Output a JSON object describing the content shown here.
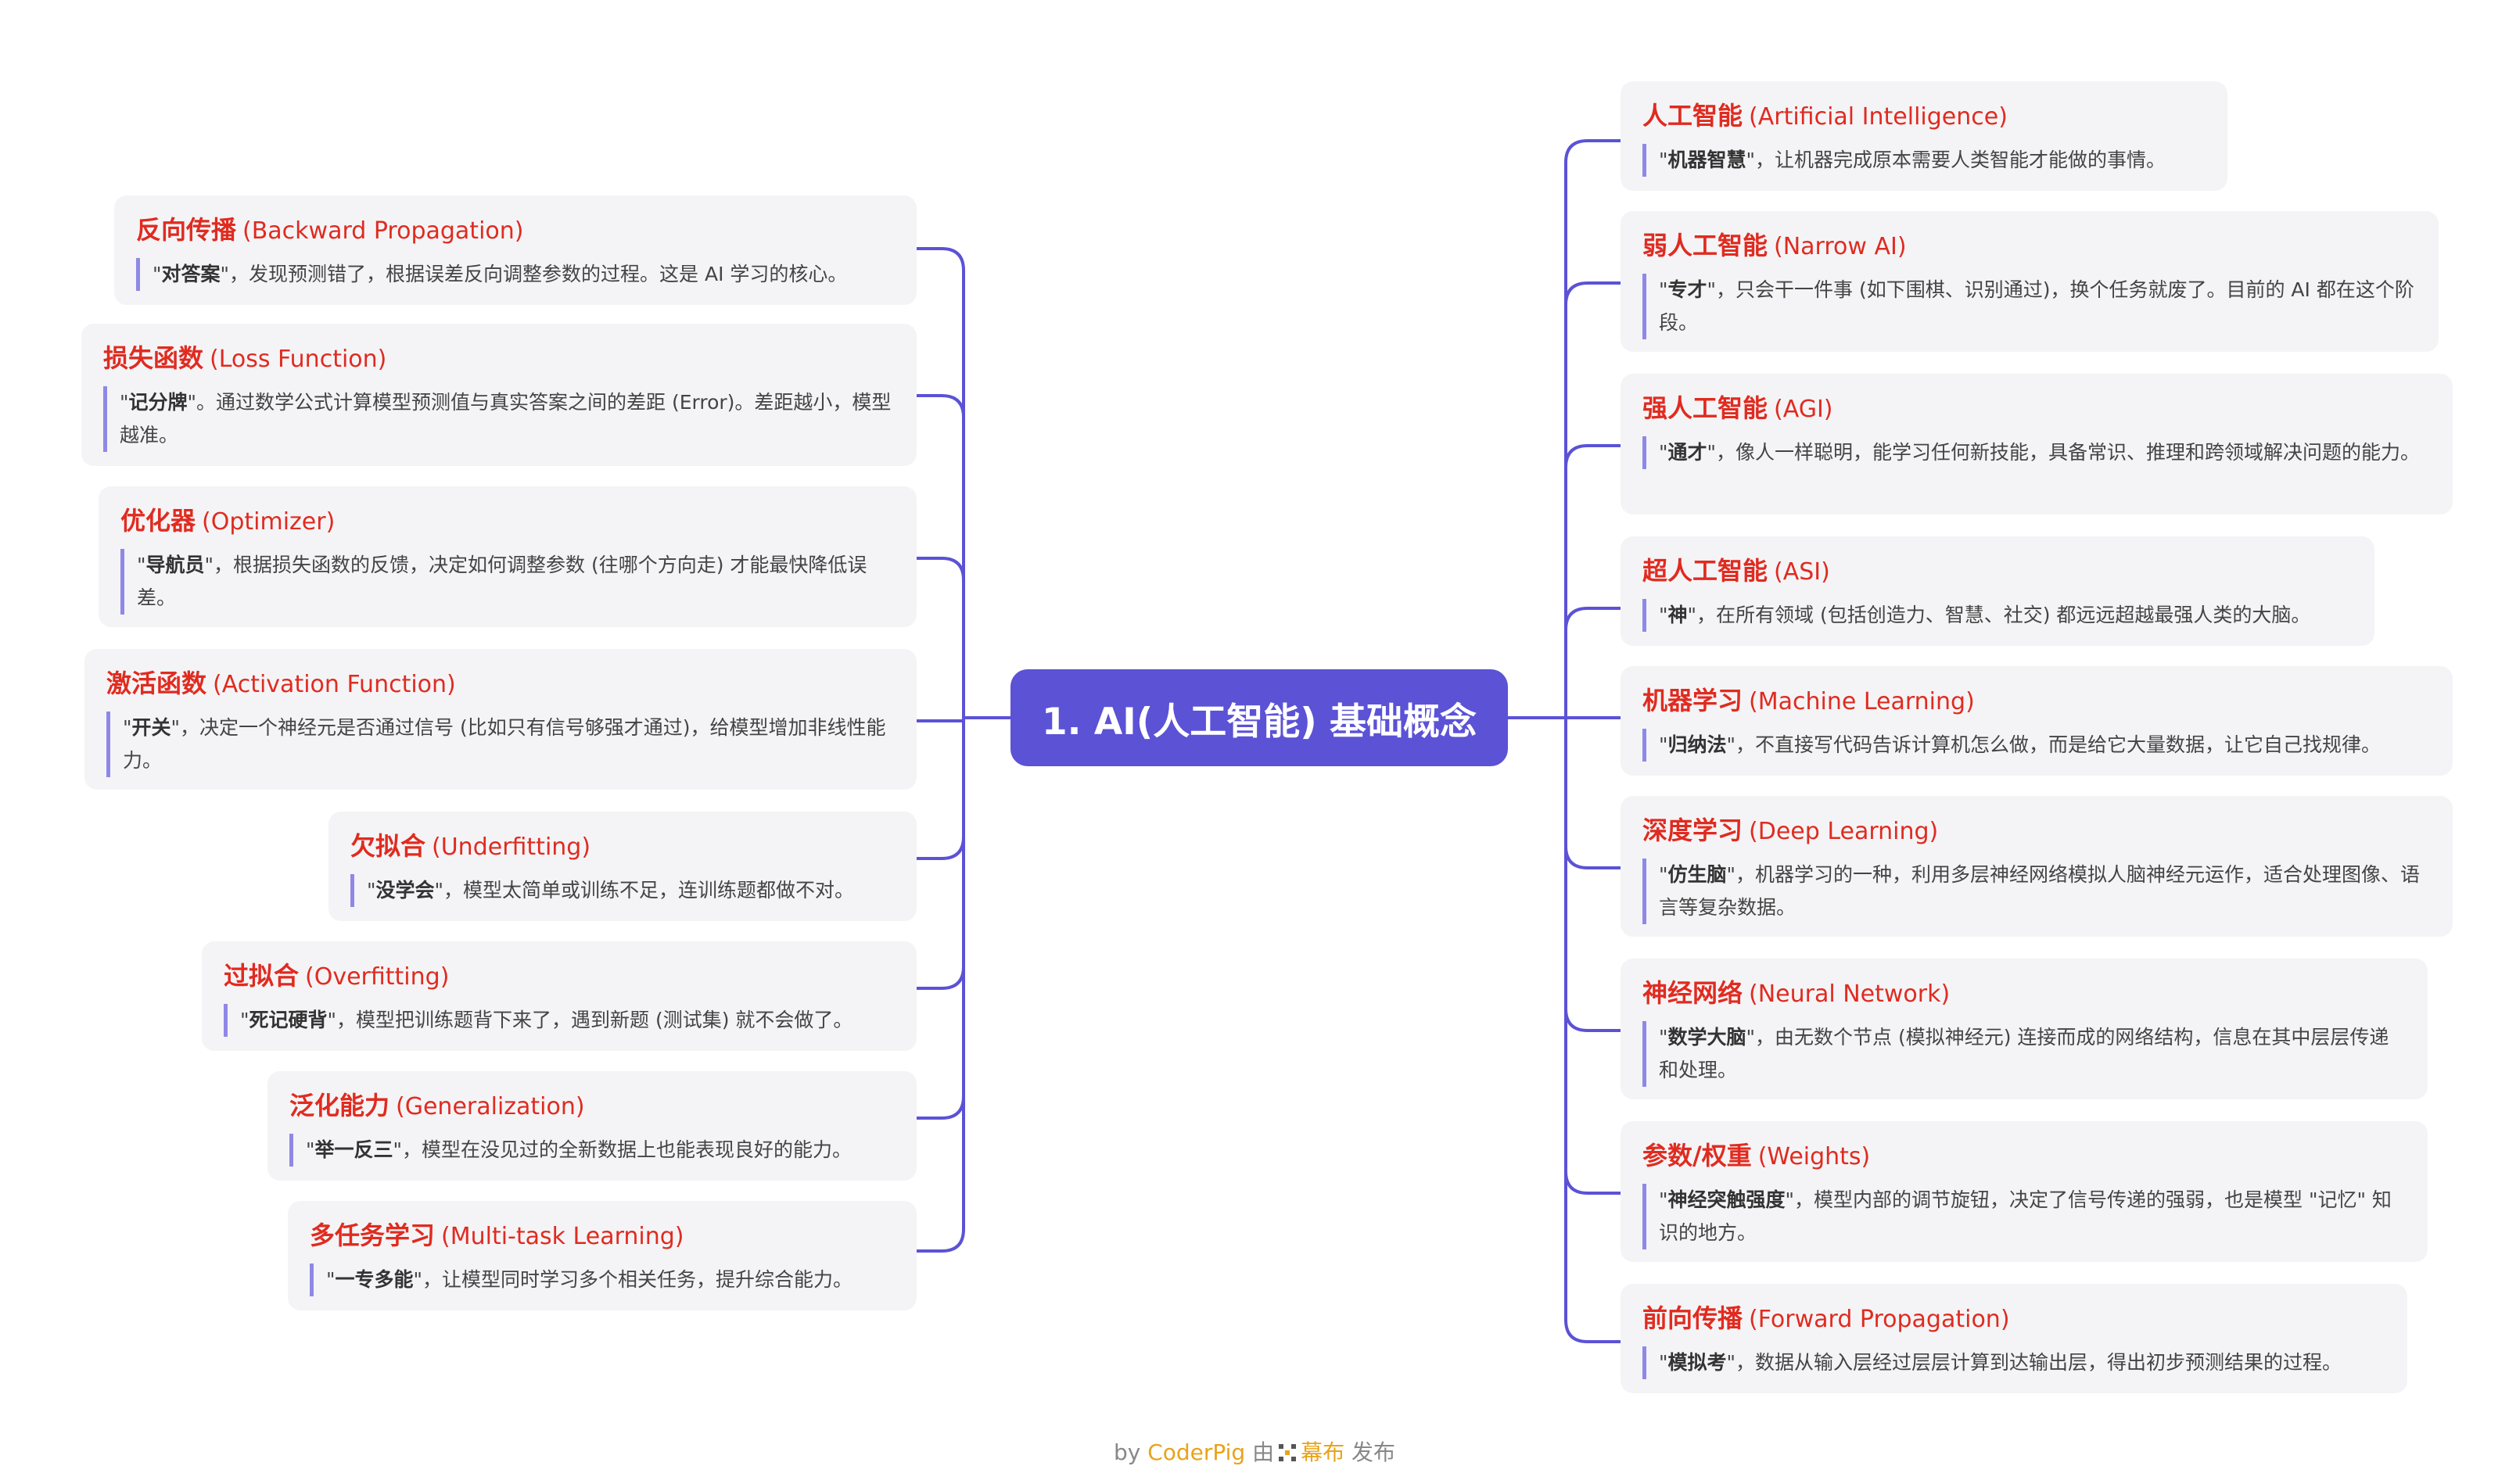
{
  "center": {
    "label": "1. AI(人工智能) 基础概念"
  },
  "right_nodes": [
    {
      "id": "ai",
      "title_zh": "人工智能",
      "title_en": "(Artificial Intelligence)",
      "bold": "机器智慧",
      "desc": "，让机器完成原本需要人类智能才能做的事情。"
    },
    {
      "id": "narrow-ai",
      "title_zh": "弱人工智能",
      "title_en": "(Narrow AI)",
      "bold": "专才",
      "desc": "，只会干一件事 (如下围棋、识别通过)，换个任务就废了。目前的 AI 都在这个阶段。"
    },
    {
      "id": "agi",
      "title_zh": "强人工智能",
      "title_en": "(AGI)",
      "bold": "通才",
      "desc": "，像人一样聪明，能学习任何新技能，具备常识、推理和跨领域解决问题的能力。"
    },
    {
      "id": "asi",
      "title_zh": "超人工智能",
      "title_en": "(ASI)",
      "bold": "神",
      "desc": "，在所有领域 (包括创造力、智慧、社交) 都远远超越最强人类的大脑。"
    },
    {
      "id": "machine-learning",
      "title_zh": "机器学习",
      "title_en": "(Machine Learning)",
      "bold": "归纳法",
      "desc": "，不直接写代码告诉计算机怎么做，而是给它大量数据，让它自己找规律。"
    },
    {
      "id": "deep-learning",
      "title_zh": "深度学习",
      "title_en": "(Deep Learning)",
      "bold": "仿生脑",
      "desc": "，机器学习的一种，利用多层神经网络模拟人脑神经元运作，适合处理图像、语言等复杂数据。"
    },
    {
      "id": "neural-network",
      "title_zh": "神经网络",
      "title_en": "(Neural Network)",
      "bold": "数学大脑",
      "desc": "，由无数个节点 (模拟神经元) 连接而成的网络结构，信息在其中层层传递和处理。"
    },
    {
      "id": "weights",
      "title_zh": "参数/权重",
      "title_en": "(Weights)",
      "bold": "神经突触强度",
      "desc": "，模型内部的调节旋钮，决定了信号传递的强弱，也是模型 \"记忆\" 知识的地方。"
    },
    {
      "id": "forward-propagation",
      "title_zh": "前向传播",
      "title_en": "(Forward Propagation)",
      "bold": "模拟考",
      "desc": "，数据从输入层经过层层计算到达输出层，得出初步预测结果的过程。"
    }
  ],
  "left_nodes": [
    {
      "id": "backward-propagation",
      "title_zh": "反向传播",
      "title_en": "(Backward Propagation)",
      "bold": "对答案",
      "desc": "，发现预测错了，根据误差反向调整参数的过程。这是 AI 学习的核心。"
    },
    {
      "id": "loss-function",
      "title_zh": "损失函数",
      "title_en": "(Loss Function)",
      "bold": "记分牌",
      "desc": "。通过数学公式计算模型预测值与真实答案之间的差距 (Error)。差距越小，模型越准。"
    },
    {
      "id": "optimizer",
      "title_zh": "优化器",
      "title_en": "(Optimizer)",
      "bold": "导航员",
      "desc": "，根据损失函数的反馈，决定如何调整参数 (往哪个方向走) 才能最快降低误差。"
    },
    {
      "id": "activation-function",
      "title_zh": "激活函数",
      "title_en": "(Activation Function)",
      "bold": "开关",
      "desc": "，决定一个神经元是否通过信号 (比如只有信号够强才通过)，给模型增加非线性能力。"
    },
    {
      "id": "underfitting",
      "title_zh": "欠拟合",
      "title_en": "(Underfitting)",
      "bold": "没学会",
      "desc": "，模型太简单或训练不足，连训练题都做不对。"
    },
    {
      "id": "overfitting",
      "title_zh": "过拟合",
      "title_en": "(Overfitting)",
      "bold": "死记硬背",
      "desc": "，模型把训练题背下来了，遇到新题 (测试集) 就不会做了。"
    },
    {
      "id": "generalization",
      "title_zh": "泛化能力",
      "title_en": "(Generalization)",
      "bold": "举一反三",
      "desc": "，模型在没见过的全新数据上也能表现良好的能力。"
    },
    {
      "id": "multi-task-learning",
      "title_zh": "多任务学习",
      "title_en": "(Multi-task Learning)",
      "bold": "一专多能",
      "desc": "，让模型同时学习多个相关任务，提升综合能力。"
    }
  ],
  "footer": {
    "by": "by",
    "author": "CoderPig",
    "via": "由",
    "app": "幕布",
    "published": "发布"
  },
  "colors": {
    "center_bg": "#5b52d6",
    "title_red": "#e02b20",
    "link": "#5b52d6",
    "node_bg": "#f4f4f6",
    "quote_bar": "#8f88e6"
  }
}
